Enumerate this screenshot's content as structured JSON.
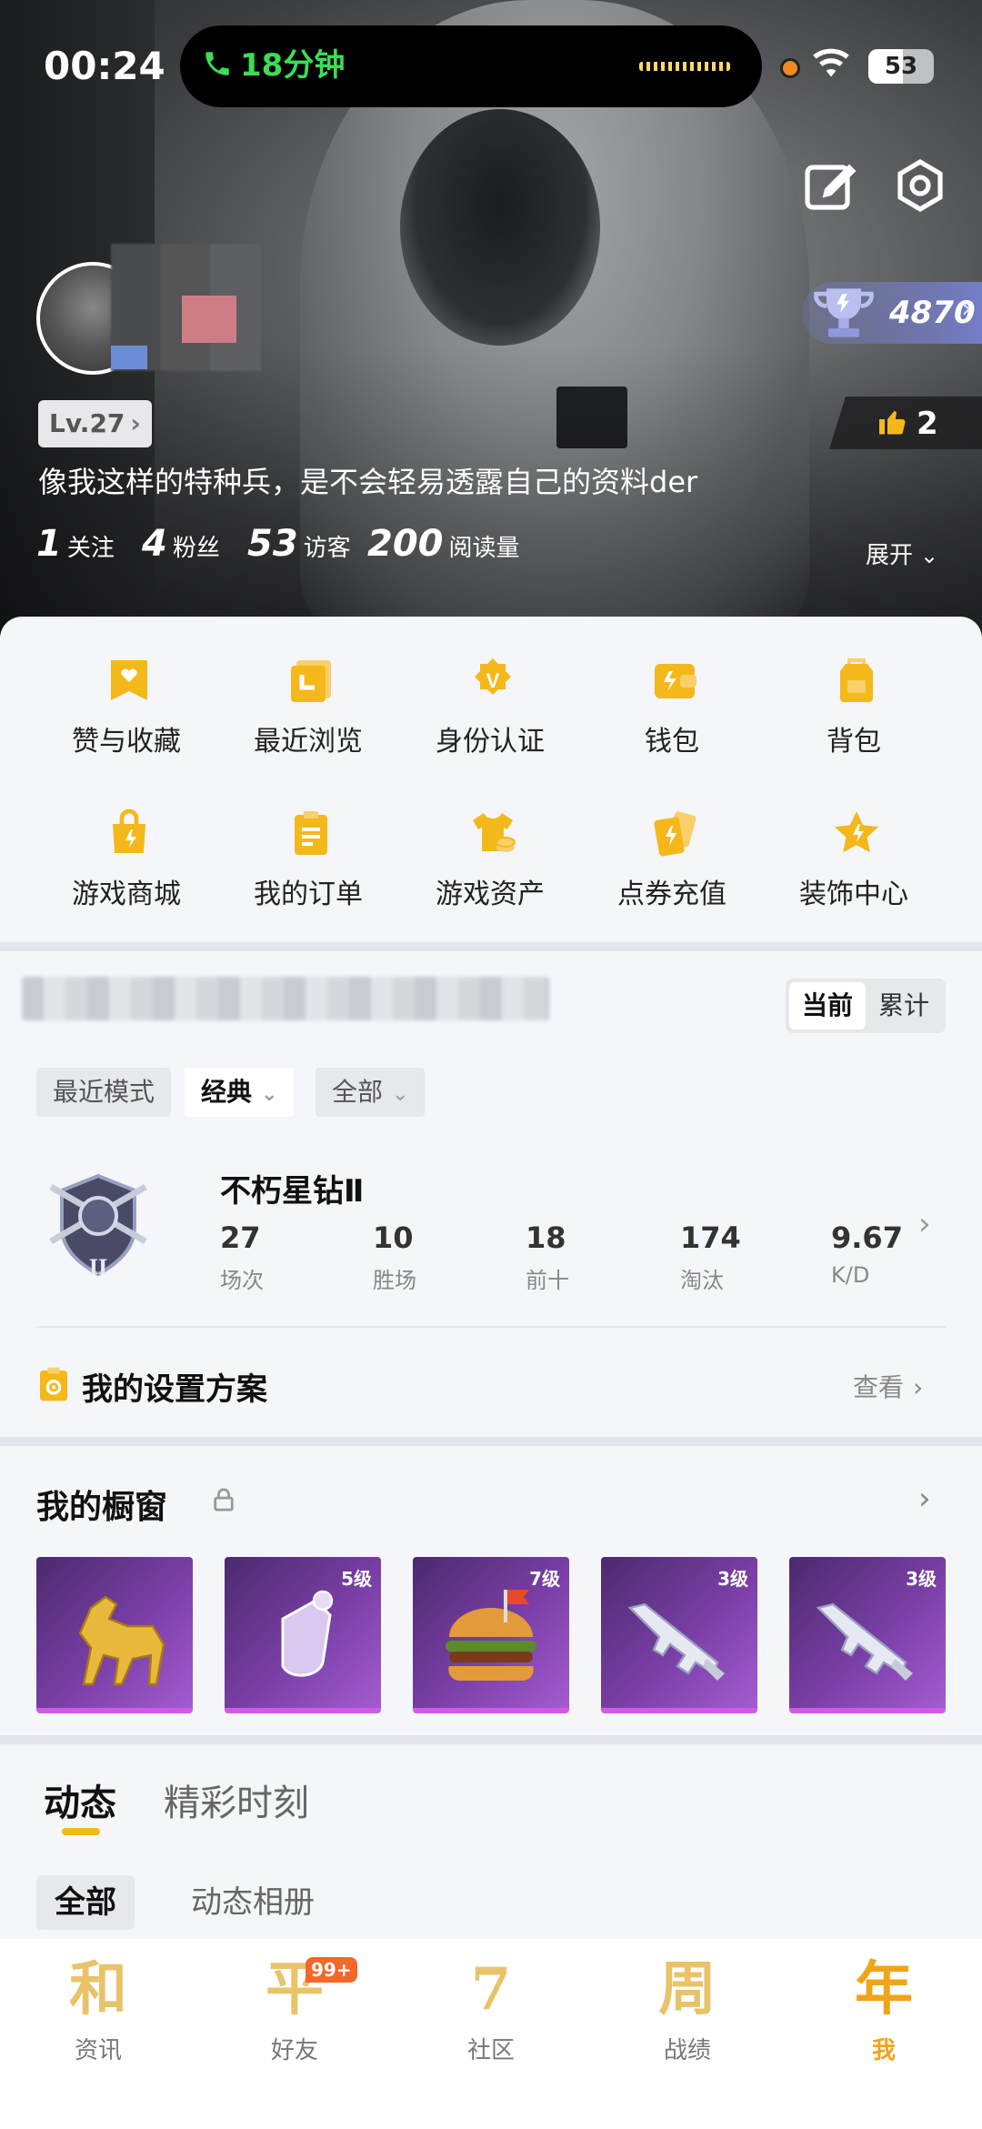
{
  "status_bar": {
    "time": "00:24",
    "call_duration": "18分钟",
    "battery": "53",
    "battery_level": 0.53
  },
  "profile": {
    "level": "Lv.27",
    "trophy_points": "4870",
    "likes": "2",
    "bio": "像我这样的特种兵，是不会轻易透露自己的资料der",
    "stats": [
      {
        "value": "1",
        "label": "关注"
      },
      {
        "value": "4",
        "label": "粉丝"
      },
      {
        "value": "53",
        "label": "访客"
      },
      {
        "value": "200",
        "label": "阅读量"
      }
    ],
    "expand_label": "展开"
  },
  "menu": {
    "items": [
      {
        "label": "赞与收藏",
        "icon": "heart-card-icon"
      },
      {
        "label": "最近浏览",
        "icon": "recent-icon"
      },
      {
        "label": "身份认证",
        "icon": "verify-icon"
      },
      {
        "label": "钱包",
        "icon": "wallet-icon"
      },
      {
        "label": "背包",
        "icon": "backpack-icon"
      },
      {
        "label": "游戏商城",
        "icon": "shop-bag-icon"
      },
      {
        "label": "我的订单",
        "icon": "order-list-icon"
      },
      {
        "label": "游戏资产",
        "icon": "tshirt-coin-icon"
      },
      {
        "label": "点券充值",
        "icon": "voucher-cards-icon"
      },
      {
        "label": "装饰中心",
        "icon": "star-decor-icon"
      }
    ]
  },
  "game": {
    "toggle": {
      "current": "当前",
      "cumulative": "累计"
    },
    "filters": {
      "mode_label": "最近模式",
      "mode_value": "经典",
      "scope_value": "全部"
    },
    "rank": {
      "name": "不朽星钻Ⅱ",
      "stats": [
        {
          "value": "27",
          "label": "场次"
        },
        {
          "value": "10",
          "label": "胜场"
        },
        {
          "value": "18",
          "label": "前十"
        },
        {
          "value": "174",
          "label": "淘汰"
        },
        {
          "value": "9.67",
          "label": "K/D"
        }
      ]
    },
    "settings_plan": {
      "title": "我的设置方案",
      "view_label": "查看"
    }
  },
  "showcase": {
    "title": "我的橱窗",
    "items": [
      {
        "level": "",
        "icon": "golden-horse-icon"
      },
      {
        "level": "5级",
        "icon": "crystal-grenade-icon"
      },
      {
        "level": "7级",
        "icon": "burger-icon"
      },
      {
        "level": "3级",
        "icon": "rifle-icon"
      },
      {
        "level": "3级",
        "icon": "rifle-icon"
      }
    ]
  },
  "feed": {
    "tabs": [
      "动态",
      "精彩时刻"
    ],
    "sub_tabs": [
      "全部",
      "动态相册"
    ]
  },
  "bottom_nav": {
    "items": [
      {
        "glyph": "和",
        "label": "资讯"
      },
      {
        "glyph": "平",
        "label": "好友",
        "badge": "99+"
      },
      {
        "glyph": "7",
        "label": "社区"
      },
      {
        "glyph": "周",
        "label": "战绩"
      },
      {
        "glyph": "年",
        "label": "我"
      }
    ]
  },
  "colors": {
    "accent": "#f5b81a",
    "active_nav": "#f0a418",
    "call_green": "#3ddc55",
    "showcase_purple": "#7a3fa6",
    "trophy_blue": "#7882d2"
  }
}
